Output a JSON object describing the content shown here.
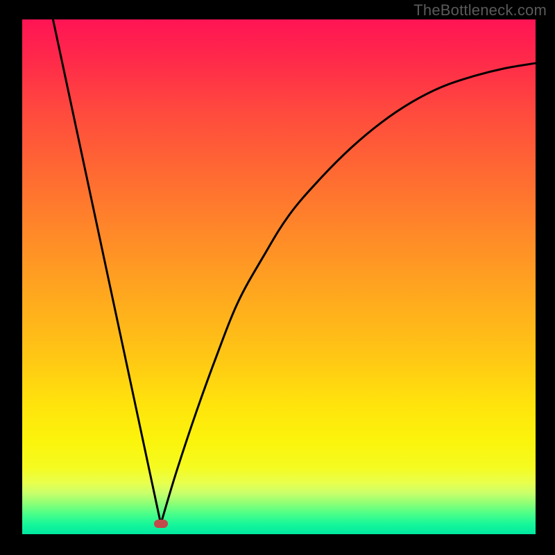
{
  "watermark": "TheBottleneck.com",
  "chart_data": {
    "type": "line",
    "title": "",
    "xlabel": "",
    "ylabel": "",
    "xlim": [
      0,
      1
    ],
    "ylim": [
      0,
      1
    ],
    "grid": false,
    "legend": false,
    "series": [
      {
        "name": "left-branch",
        "x": [
          0.06,
          0.27
        ],
        "values": [
          1.0,
          0.02
        ]
      },
      {
        "name": "right-branch",
        "x": [
          0.27,
          0.3,
          0.34,
          0.38,
          0.42,
          0.47,
          0.52,
          0.58,
          0.64,
          0.7,
          0.76,
          0.82,
          0.88,
          0.94,
          1.0
        ],
        "values": [
          0.02,
          0.12,
          0.24,
          0.35,
          0.45,
          0.54,
          0.62,
          0.69,
          0.75,
          0.8,
          0.84,
          0.87,
          0.89,
          0.905,
          0.915
        ]
      }
    ],
    "marker": {
      "x": 0.27,
      "y": 0.02,
      "color": "#c14a4a"
    },
    "background_gradient": [
      "#ff1454",
      "#ffa91e",
      "#fbf40c",
      "#00e8a0"
    ]
  }
}
